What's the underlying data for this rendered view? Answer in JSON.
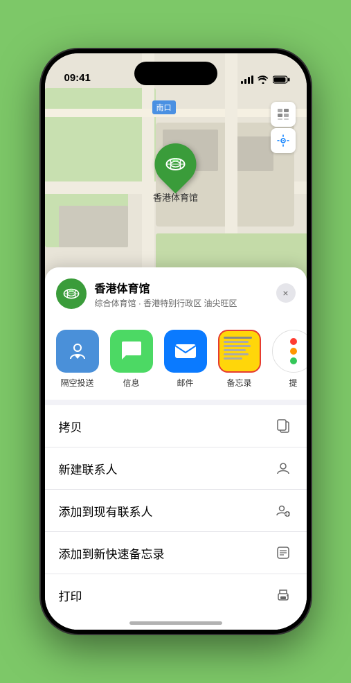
{
  "status_bar": {
    "time": "09:41",
    "location_arrow": "▶"
  },
  "map": {
    "label": "南口",
    "pin_name": "香港体育馆",
    "pin_label": "香港体育馆"
  },
  "venue": {
    "name": "香港体育馆",
    "subtitle": "综合体育馆 · 香港特别行政区 油尖旺区",
    "close_label": "×"
  },
  "share_items": [
    {
      "id": "airdrop",
      "label": "隔空投送",
      "bg": "#4a90d9",
      "icon": "📡"
    },
    {
      "id": "messages",
      "label": "信息",
      "bg": "#4cd964",
      "icon": "💬"
    },
    {
      "id": "mail",
      "label": "邮件",
      "bg": "#0a7aff",
      "icon": "✉️"
    },
    {
      "id": "notes",
      "label": "备忘录",
      "icon": "notes"
    },
    {
      "id": "more",
      "label": "提",
      "icon": "more"
    }
  ],
  "actions": [
    {
      "label": "拷贝",
      "icon": "copy"
    },
    {
      "label": "新建联系人",
      "icon": "person"
    },
    {
      "label": "添加到现有联系人",
      "icon": "person-add"
    },
    {
      "label": "添加到新快速备忘录",
      "icon": "note"
    },
    {
      "label": "打印",
      "icon": "print"
    }
  ]
}
